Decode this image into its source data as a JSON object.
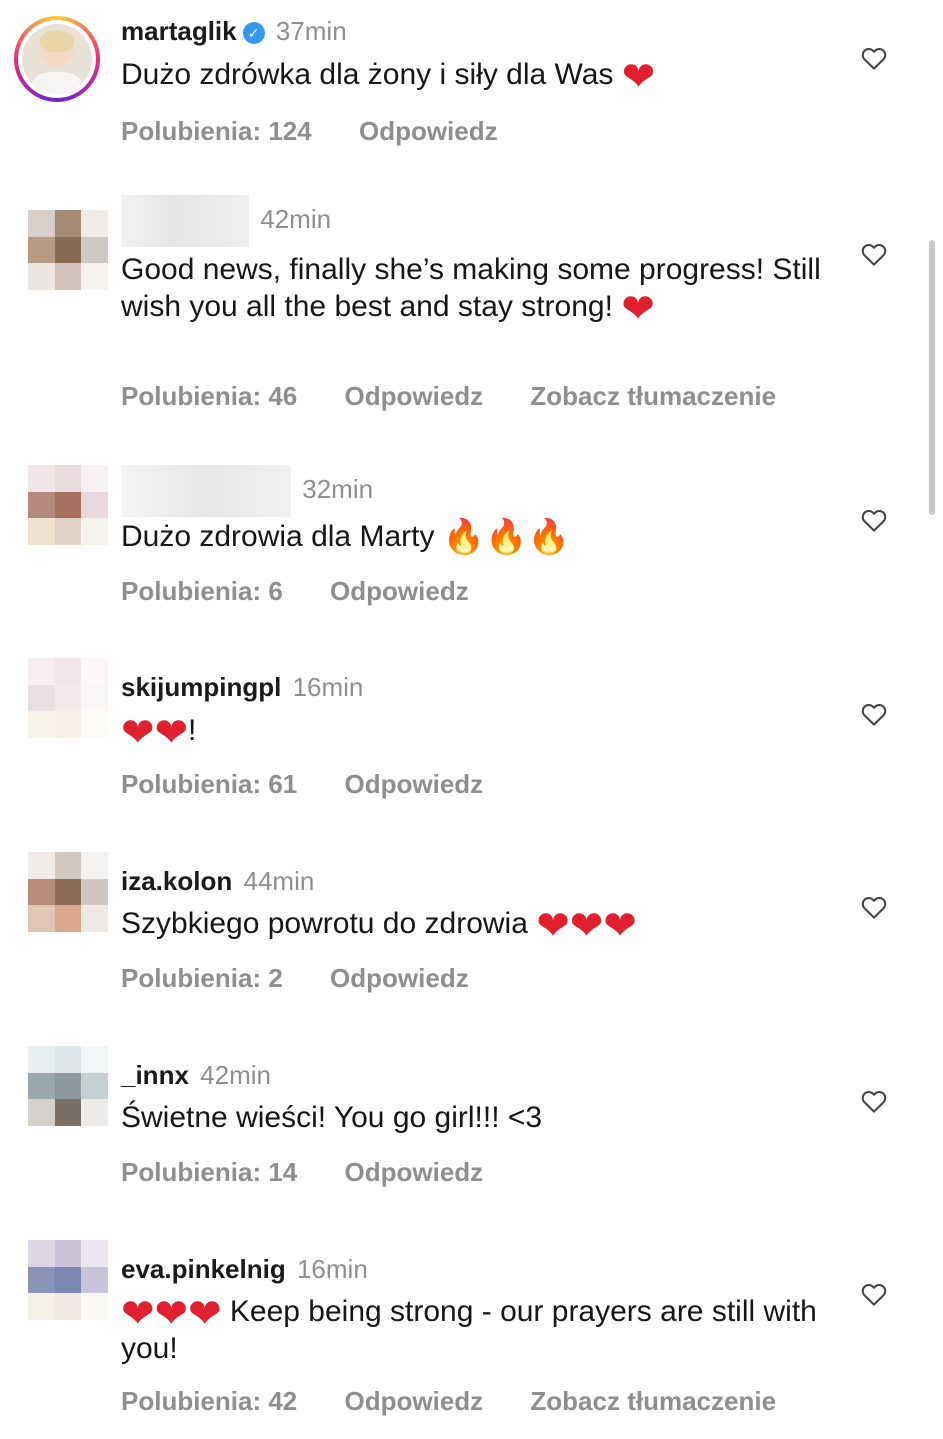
{
  "comments": [
    {
      "username": "martaglik",
      "verified": true,
      "time": "37min",
      "text": "Dużo zdrówka dla żony i siły dla Was",
      "emoji": "heart",
      "emoji_count": 1,
      "likes": "Polubienia: 124",
      "reply": "Odpowiedz",
      "translate": ""
    },
    {
      "username": "",
      "time": "42min",
      "text": "Good news, finally she’s making some progress! Still wish you all the best and stay strong!",
      "emoji": "heart",
      "emoji_count": 1,
      "likes": "Polubienia: 46",
      "reply": "Odpowiedz",
      "translate": "Zobacz tłumaczenie"
    },
    {
      "username": "",
      "time": "32min",
      "text": "Dużo zdrowia dla Marty",
      "emoji": "fire",
      "emoji_count": 3,
      "likes": "Polubienia: 6",
      "reply": "Odpowiedz",
      "translate": ""
    },
    {
      "username": "skijumpingpl",
      "time": "16min",
      "text": "!",
      "emoji": "heart",
      "emoji_count": 2,
      "likes": "Polubienia: 61",
      "reply": "Odpowiedz",
      "translate": ""
    },
    {
      "username": "iza.kolon",
      "time": "44min",
      "text": "Szybkiego powrotu do zdrowia",
      "emoji": "heart",
      "emoji_count": 3,
      "likes": "Polubienia: 2",
      "reply": "Odpowiedz",
      "translate": ""
    },
    {
      "username": "_innx",
      "time": "42min",
      "text": "Świetne wieści! You go girl!!! <3",
      "emoji": "",
      "emoji_count": 0,
      "likes": "Polubienia: 14",
      "reply": "Odpowiedz",
      "translate": ""
    },
    {
      "username": "eva.pinkelnig",
      "time": "16min",
      "text": "Keep being strong - our prayers are still with you!",
      "emoji": "heart",
      "emoji_count": 3,
      "likes": "Polubienia: 42",
      "reply": "Odpowiedz",
      "translate": "Zobacz tłumaczenie"
    }
  ],
  "icons": {
    "like": "heart-outline-icon",
    "verified": "verified-badge-icon"
  },
  "colors": {
    "muted": "#8e8e8e",
    "heart": "#e0202e",
    "verified": "#3897f0"
  }
}
